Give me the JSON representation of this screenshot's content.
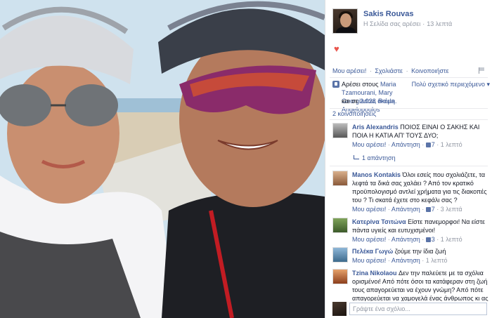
{
  "page": {
    "name": "Sakis Rouvas",
    "liked_status": "Η Σελίδα σας αρέσει",
    "time": "13 λεπτά"
  },
  "actions": {
    "like": "Μου αρέσει!",
    "comment": "Σχολιάστε",
    "share": "Κοινοποιήστε"
  },
  "likes": {
    "prefix": "Αρέσει στους",
    "names": "Maria Tzamourani, Mary Georgiadou, Roula Angelopoulos",
    "suffix": "και σε",
    "count": "2.028 ακόμη.",
    "relevance": "Πολύ σχετικό περιεχόμενο ▾"
  },
  "shares": "2 κοινοποιήσεις",
  "comments": [
    {
      "author": "Aris Alexandris",
      "text": "ΠΟΙΟΣ ΕΙΝΑΙ Ο ΣΑΚΗΣ ΚΑΙ ΠΟΙΑ Η ΚΑΤΙΑ ΑΠ' ΤΟΥΣ ΔΥΟ;",
      "like": "Μου αρέσει!",
      "reply": "Απάντηση",
      "likes": "7",
      "time": "1 λεπτό"
    },
    {
      "author": "Manos Kontakis",
      "text": "Όλοι εσείς που σχολιάζετε, τα λεφτά τα δικά σας χαλάει ? Από τον κρατικό προϋπολογισμό αντλεί χρήματα για τις διακοπές του ? Τι σκατά έχετε στο κεφάλι σας ?",
      "like": "Μου αρέσει!",
      "reply": "Απάντηση",
      "likes": "7",
      "time": "3 λεπτά"
    },
    {
      "author": "Κατερίνα Τσιτώνα",
      "text": "Είστε πανεμορφοι! Να είστε πάντα υγιείς και ευτυχισμένοι!",
      "like": "Μου αρέσει!",
      "reply": "Απάντηση",
      "likes": "3",
      "time": "1 λεπτό"
    },
    {
      "author": "Πελέκα Γωγώ",
      "text": "ζούμε την ίδια ζωή",
      "like": "Μου αρέσει!",
      "reply": "Απάντηση",
      "likes": "",
      "time": "1 λεπτό"
    },
    {
      "author": "Tzina Nikolaou",
      "text": "Δεν την παλεύετε με τα σχόλια ορισμένοι! Από πότε όσοι τα κατάφεραν στη ζωή τους απαγορεύεται να έχουν γνώμη? Από πότε απαγορεύεται να χαμογελά ένας άνθρωπος κι ας",
      "like": "",
      "reply": "",
      "likes": "",
      "time": ""
    }
  ],
  "reply_toggle": "1 απάντηση",
  "comment_input": {
    "placeholder": "Γράψτε ένα σχόλιο..."
  },
  "colors": {
    "link": "#3b5998",
    "muted": "#9197a3",
    "heart": "#e9554d"
  },
  "icons": [
    "heart-icon",
    "thumbs-up-icon",
    "flag-icon",
    "reply-arrow-icon"
  ]
}
